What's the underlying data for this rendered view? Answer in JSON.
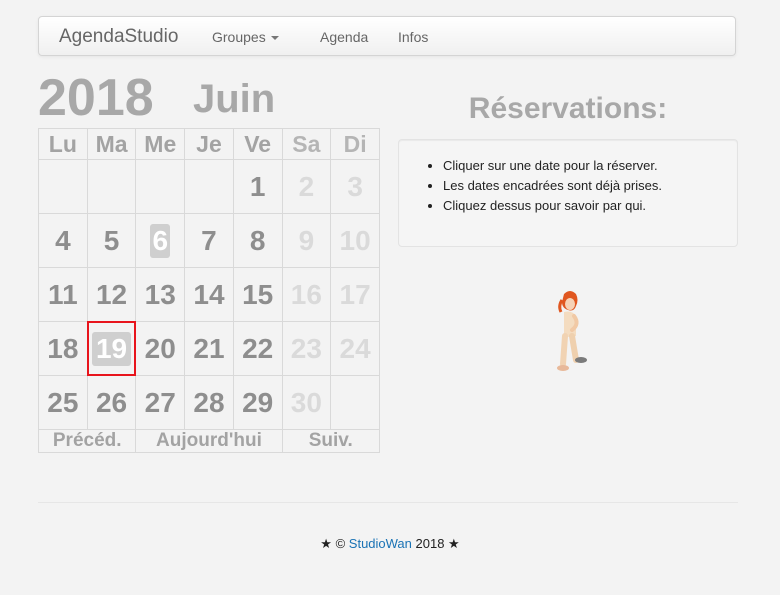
{
  "navbar": {
    "brand": "AgendaStudio",
    "items": [
      {
        "label": "Groupes",
        "dropdown": true
      },
      {
        "label": "Agenda"
      },
      {
        "label": "Infos"
      }
    ]
  },
  "calendar": {
    "year": "2018",
    "month": "Juin",
    "weekdays": [
      "Lu",
      "Ma",
      "Me",
      "Je",
      "Ve",
      "Sa",
      "Di"
    ],
    "weeks": [
      [
        "",
        "",
        "",
        "",
        "1",
        "2",
        "3"
      ],
      [
        "4",
        "5",
        "6",
        "7",
        "8",
        "9",
        "10"
      ],
      [
        "11",
        "12",
        "13",
        "14",
        "15",
        "16",
        "17"
      ],
      [
        "18",
        "19",
        "20",
        "21",
        "22",
        "23",
        "24"
      ],
      [
        "25",
        "26",
        "27",
        "28",
        "29",
        "30",
        ""
      ]
    ],
    "booked_days": [
      "6"
    ],
    "today": "19",
    "nav": {
      "prev": "Précéd.",
      "today": "Aujourd'hui",
      "next": "Suiv."
    }
  },
  "reservations": {
    "title": "Réservations:",
    "instructions": [
      "Cliquer sur une date pour la réserver.",
      "Les dates encadrées sont déjà prises.",
      "Cliquez dessus pour savoir par qui."
    ]
  },
  "footer": {
    "star_left": "★ ©",
    "link": "StudioWan",
    "year_star": "2018 ★"
  },
  "colors": {
    "today_border": "#e8141c",
    "link": "#1a73b5",
    "calendar_text": "#a8a8a8"
  }
}
